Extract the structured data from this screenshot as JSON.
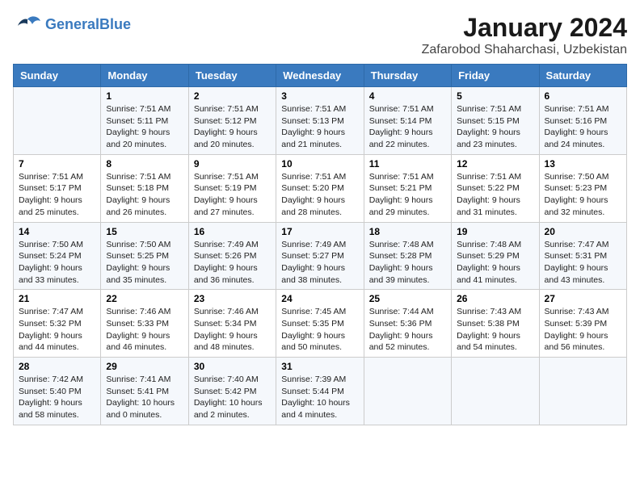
{
  "header": {
    "logo_line1": "General",
    "logo_line2": "Blue",
    "title": "January 2024",
    "subtitle": "Zafarobod Shaharchasi, Uzbekistan"
  },
  "columns": [
    "Sunday",
    "Monday",
    "Tuesday",
    "Wednesday",
    "Thursday",
    "Friday",
    "Saturday"
  ],
  "weeks": [
    [
      {
        "day": "",
        "sunrise": "",
        "sunset": "",
        "daylight": ""
      },
      {
        "day": "1",
        "sunrise": "Sunrise: 7:51 AM",
        "sunset": "Sunset: 5:11 PM",
        "daylight": "Daylight: 9 hours and 20 minutes."
      },
      {
        "day": "2",
        "sunrise": "Sunrise: 7:51 AM",
        "sunset": "Sunset: 5:12 PM",
        "daylight": "Daylight: 9 hours and 20 minutes."
      },
      {
        "day": "3",
        "sunrise": "Sunrise: 7:51 AM",
        "sunset": "Sunset: 5:13 PM",
        "daylight": "Daylight: 9 hours and 21 minutes."
      },
      {
        "day": "4",
        "sunrise": "Sunrise: 7:51 AM",
        "sunset": "Sunset: 5:14 PM",
        "daylight": "Daylight: 9 hours and 22 minutes."
      },
      {
        "day": "5",
        "sunrise": "Sunrise: 7:51 AM",
        "sunset": "Sunset: 5:15 PM",
        "daylight": "Daylight: 9 hours and 23 minutes."
      },
      {
        "day": "6",
        "sunrise": "Sunrise: 7:51 AM",
        "sunset": "Sunset: 5:16 PM",
        "daylight": "Daylight: 9 hours and 24 minutes."
      }
    ],
    [
      {
        "day": "7",
        "sunrise": "Sunrise: 7:51 AM",
        "sunset": "Sunset: 5:17 PM",
        "daylight": "Daylight: 9 hours and 25 minutes."
      },
      {
        "day": "8",
        "sunrise": "Sunrise: 7:51 AM",
        "sunset": "Sunset: 5:18 PM",
        "daylight": "Daylight: 9 hours and 26 minutes."
      },
      {
        "day": "9",
        "sunrise": "Sunrise: 7:51 AM",
        "sunset": "Sunset: 5:19 PM",
        "daylight": "Daylight: 9 hours and 27 minutes."
      },
      {
        "day": "10",
        "sunrise": "Sunrise: 7:51 AM",
        "sunset": "Sunset: 5:20 PM",
        "daylight": "Daylight: 9 hours and 28 minutes."
      },
      {
        "day": "11",
        "sunrise": "Sunrise: 7:51 AM",
        "sunset": "Sunset: 5:21 PM",
        "daylight": "Daylight: 9 hours and 29 minutes."
      },
      {
        "day": "12",
        "sunrise": "Sunrise: 7:51 AM",
        "sunset": "Sunset: 5:22 PM",
        "daylight": "Daylight: 9 hours and 31 minutes."
      },
      {
        "day": "13",
        "sunrise": "Sunrise: 7:50 AM",
        "sunset": "Sunset: 5:23 PM",
        "daylight": "Daylight: 9 hours and 32 minutes."
      }
    ],
    [
      {
        "day": "14",
        "sunrise": "Sunrise: 7:50 AM",
        "sunset": "Sunset: 5:24 PM",
        "daylight": "Daylight: 9 hours and 33 minutes."
      },
      {
        "day": "15",
        "sunrise": "Sunrise: 7:50 AM",
        "sunset": "Sunset: 5:25 PM",
        "daylight": "Daylight: 9 hours and 35 minutes."
      },
      {
        "day": "16",
        "sunrise": "Sunrise: 7:49 AM",
        "sunset": "Sunset: 5:26 PM",
        "daylight": "Daylight: 9 hours and 36 minutes."
      },
      {
        "day": "17",
        "sunrise": "Sunrise: 7:49 AM",
        "sunset": "Sunset: 5:27 PM",
        "daylight": "Daylight: 9 hours and 38 minutes."
      },
      {
        "day": "18",
        "sunrise": "Sunrise: 7:48 AM",
        "sunset": "Sunset: 5:28 PM",
        "daylight": "Daylight: 9 hours and 39 minutes."
      },
      {
        "day": "19",
        "sunrise": "Sunrise: 7:48 AM",
        "sunset": "Sunset: 5:29 PM",
        "daylight": "Daylight: 9 hours and 41 minutes."
      },
      {
        "day": "20",
        "sunrise": "Sunrise: 7:47 AM",
        "sunset": "Sunset: 5:31 PM",
        "daylight": "Daylight: 9 hours and 43 minutes."
      }
    ],
    [
      {
        "day": "21",
        "sunrise": "Sunrise: 7:47 AM",
        "sunset": "Sunset: 5:32 PM",
        "daylight": "Daylight: 9 hours and 44 minutes."
      },
      {
        "day": "22",
        "sunrise": "Sunrise: 7:46 AM",
        "sunset": "Sunset: 5:33 PM",
        "daylight": "Daylight: 9 hours and 46 minutes."
      },
      {
        "day": "23",
        "sunrise": "Sunrise: 7:46 AM",
        "sunset": "Sunset: 5:34 PM",
        "daylight": "Daylight: 9 hours and 48 minutes."
      },
      {
        "day": "24",
        "sunrise": "Sunrise: 7:45 AM",
        "sunset": "Sunset: 5:35 PM",
        "daylight": "Daylight: 9 hours and 50 minutes."
      },
      {
        "day": "25",
        "sunrise": "Sunrise: 7:44 AM",
        "sunset": "Sunset: 5:36 PM",
        "daylight": "Daylight: 9 hours and 52 minutes."
      },
      {
        "day": "26",
        "sunrise": "Sunrise: 7:43 AM",
        "sunset": "Sunset: 5:38 PM",
        "daylight": "Daylight: 9 hours and 54 minutes."
      },
      {
        "day": "27",
        "sunrise": "Sunrise: 7:43 AM",
        "sunset": "Sunset: 5:39 PM",
        "daylight": "Daylight: 9 hours and 56 minutes."
      }
    ],
    [
      {
        "day": "28",
        "sunrise": "Sunrise: 7:42 AM",
        "sunset": "Sunset: 5:40 PM",
        "daylight": "Daylight: 9 hours and 58 minutes."
      },
      {
        "day": "29",
        "sunrise": "Sunrise: 7:41 AM",
        "sunset": "Sunset: 5:41 PM",
        "daylight": "Daylight: 10 hours and 0 minutes."
      },
      {
        "day": "30",
        "sunrise": "Sunrise: 7:40 AM",
        "sunset": "Sunset: 5:42 PM",
        "daylight": "Daylight: 10 hours and 2 minutes."
      },
      {
        "day": "31",
        "sunrise": "Sunrise: 7:39 AM",
        "sunset": "Sunset: 5:44 PM",
        "daylight": "Daylight: 10 hours and 4 minutes."
      },
      {
        "day": "",
        "sunrise": "",
        "sunset": "",
        "daylight": ""
      },
      {
        "day": "",
        "sunrise": "",
        "sunset": "",
        "daylight": ""
      },
      {
        "day": "",
        "sunrise": "",
        "sunset": "",
        "daylight": ""
      }
    ]
  ]
}
